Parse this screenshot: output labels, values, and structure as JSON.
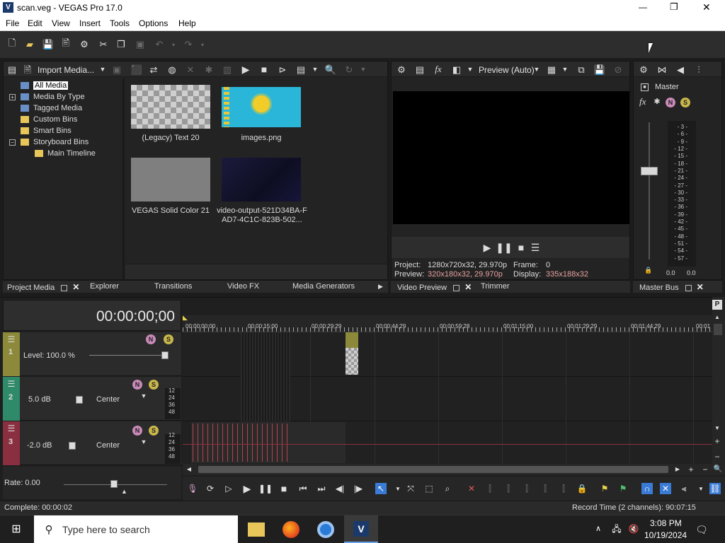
{
  "window": {
    "title": "scan.veg - VEGAS Pro 17.0",
    "min": "—",
    "max": "❐",
    "close": "✕"
  },
  "menu": [
    "File",
    "Edit",
    "View",
    "Insert",
    "Tools",
    "Options",
    "Help"
  ],
  "project_media": {
    "import_label": "Import Media...",
    "tree": [
      "All Media",
      "Media By Type",
      "Tagged Media",
      "Custom Bins",
      "Smart Bins",
      "Storyboard Bins",
      "Main Timeline"
    ],
    "expanders": [
      "+",
      "−"
    ],
    "items": [
      {
        "caption": "(Legacy) Text 20"
      },
      {
        "caption": "images.png"
      },
      {
        "caption": "VEGAS Solid Color 21"
      },
      {
        "caption": "video-output-521D34BA-FAD7-4C1C-823B-502..."
      }
    ],
    "tabs": [
      "Project Media",
      "Explorer",
      "Transitions",
      "Video FX",
      "Media Generators"
    ]
  },
  "preview": {
    "mode_label": "Preview (Auto)",
    "project_label": "Project:",
    "project_value": "1280x720x32, 29.970p",
    "frame_label": "Frame:",
    "frame_value": "0",
    "preview_label": "Preview:",
    "preview_value": "320x180x32, 29.970p",
    "display_label": "Display:",
    "display_value": "335x188x32",
    "tabs": [
      "Video Preview",
      "Trimmer"
    ],
    "accent": "#e8a0a0"
  },
  "master": {
    "label": "Master",
    "fx_label": "fx",
    "scale": [
      "3",
      "6",
      "9",
      "12",
      "15",
      "18",
      "21",
      "24",
      "27",
      "30",
      "33",
      "36",
      "39",
      "42",
      "45",
      "48",
      "51",
      "54",
      "57"
    ],
    "readouts": [
      "0.0",
      "0.0"
    ],
    "tab": "Master Bus"
  },
  "timeline": {
    "timecode": "00:00:00;00",
    "ruler": [
      "00:00:00;00",
      "00:00:15;00",
      "00:00:29;29",
      "00:00:44;29",
      "00:00:59;28",
      "00:01:15;00",
      "00:01:29;29",
      "00:01:44;29",
      "00:01"
    ],
    "tracks": [
      {
        "num": "1",
        "level_text": "Level: 100.0 %",
        "color": "#8c8a3a"
      },
      {
        "num": "2",
        "vol": "5.0 dB",
        "pan": "Center",
        "color": "#2f8a6a"
      },
      {
        "num": "3",
        "vol": "-2.0 dB",
        "pan": "Center",
        "color": "#8a2f3f"
      }
    ],
    "db_marks": [
      "12",
      "24",
      "36",
      "48"
    ],
    "rate": "Rate: 0.00"
  },
  "status": {
    "left": "Complete: 00:00:02",
    "right": "Record Time (2 channels): 90:07:15"
  },
  "taskbar": {
    "search_placeholder": "Type here to search",
    "time": "3:08 PM",
    "date": "10/19/2024"
  },
  "colors": {
    "panel": "#232323",
    "accent_blue": "#3a7bd5"
  }
}
